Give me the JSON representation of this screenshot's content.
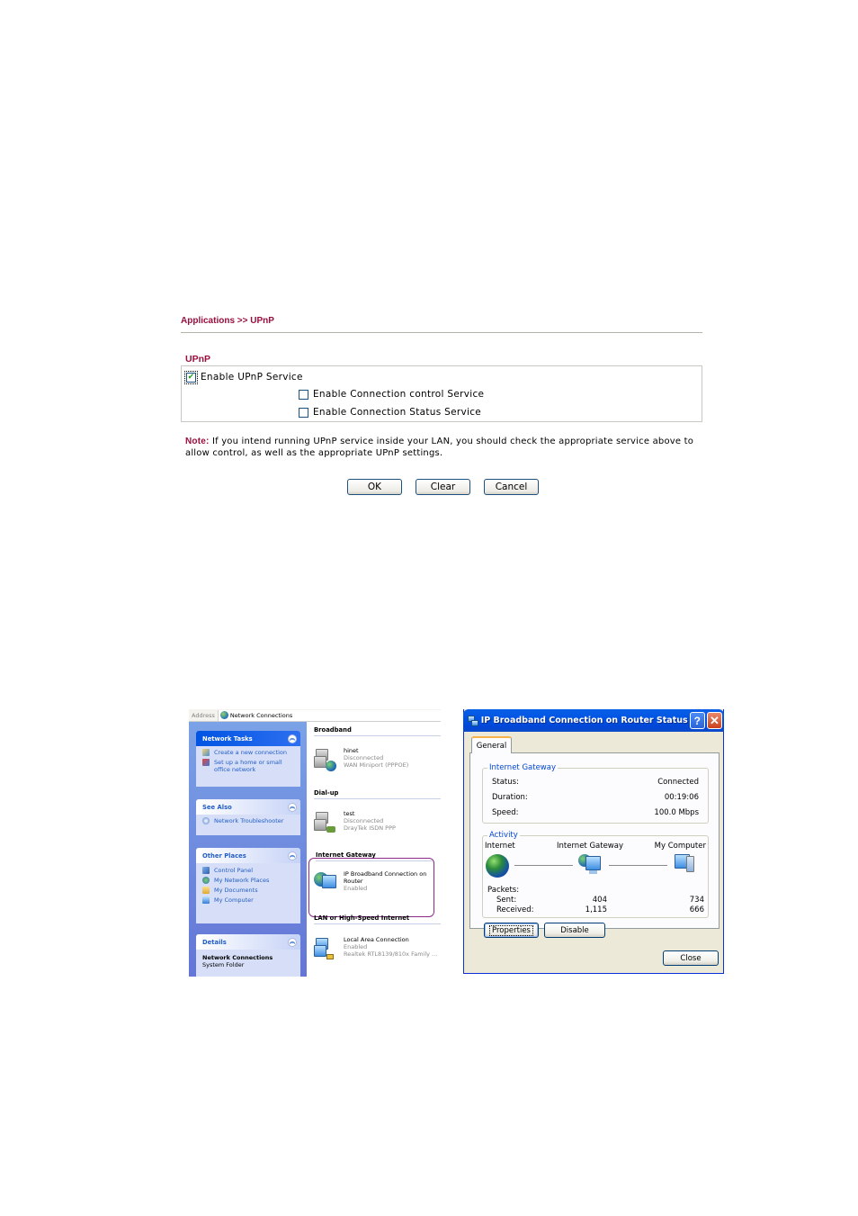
{
  "upnp": {
    "breadcrumb": "Applications >> UPnP",
    "section_title": "UPnP",
    "options": [
      {
        "label": "Enable UPnP Service",
        "checked": true
      },
      {
        "label": "Enable Connection control Service",
        "checked": false
      },
      {
        "label": "Enable Connection Status Service",
        "checked": false
      }
    ],
    "note_label": "Note:",
    "note_text": " If you intend running UPnP service inside your LAN, you should check the appropriate service above to allow control, as well as the appropriate UPnP settings.",
    "buttons": {
      "ok": "OK",
      "clear": "Clear",
      "cancel": "Cancel"
    },
    "accent_color": "#9a0e3c"
  },
  "network_connections": {
    "address_label": "Address",
    "address_value": "Network Connections",
    "task_panes": [
      {
        "title": "Network Tasks",
        "items": [
          "Create a new connection",
          "Set up a home or small office network"
        ]
      },
      {
        "title": "See Also",
        "items": [
          "Network Troubleshooter"
        ]
      },
      {
        "title": "Other Places",
        "items": [
          "Control Panel",
          "My Network Places",
          "My Documents",
          "My Computer"
        ]
      },
      {
        "title": "Details",
        "detail_title": "Network Connections",
        "detail_sub": "System Folder"
      }
    ],
    "groups": [
      {
        "title": "Broadband",
        "connection": {
          "name": "hinet",
          "status": "Disconnected",
          "device": "WAN Miniport (PPPOE)"
        }
      },
      {
        "title": "Dial-up",
        "connection": {
          "name": "test",
          "status": "Disconnected",
          "device": "DrayTek ISDN PPP"
        }
      },
      {
        "title": "Internet Gateway",
        "connection": {
          "name": "IP Broadband Connection on Router",
          "status": "Enabled"
        }
      },
      {
        "title": "LAN or High-Speed Internet",
        "connection": {
          "name": "Local Area Connection",
          "status": "Enabled",
          "device": "Realtek RTL8139/810x Family ..."
        }
      }
    ]
  },
  "status_dialog": {
    "title": "IP Broadband Connection on Router Status",
    "help_glyph": "?",
    "close_glyph": "✕",
    "tab": "General",
    "gateway_group": "Internet Gateway",
    "status_label": "Status:",
    "status_value": "Connected",
    "duration_label": "Duration:",
    "duration_value": "00:19:06",
    "speed_label": "Speed:",
    "speed_value": "100.0 Mbps",
    "activity_group": "Activity",
    "activity_nodes": [
      "Internet",
      "Internet Gateway",
      "My Computer"
    ],
    "packets_label": "Packets:",
    "sent_label": "Sent:",
    "received_label": "Received:",
    "sent_gateway": "404",
    "sent_computer": "734",
    "received_gateway": "1,115",
    "received_computer": "666",
    "properties_button": "Properties",
    "disable_button": "Disable",
    "close_button": "Close"
  }
}
